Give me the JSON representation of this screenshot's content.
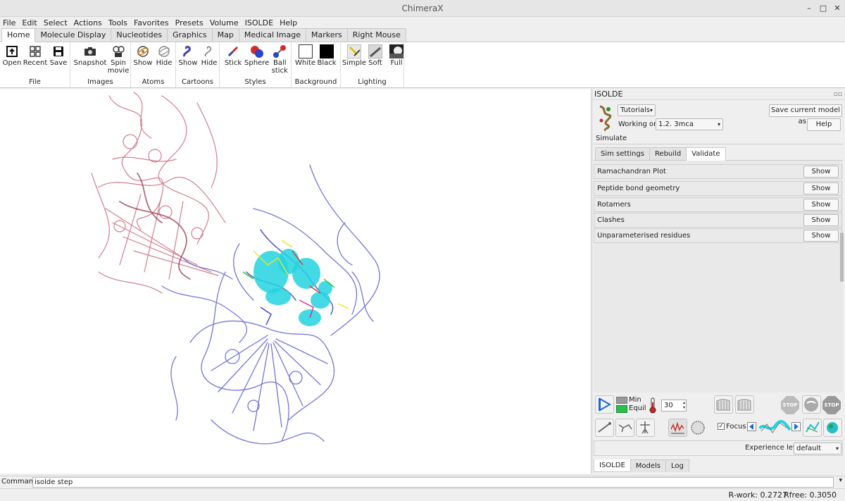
{
  "window": {
    "title": "ChimeraX",
    "minimize": "–",
    "maximize": "□",
    "close": "✕"
  },
  "menu": [
    "File",
    "Edit",
    "Select",
    "Actions",
    "Tools",
    "Favorites",
    "Presets",
    "Volume",
    "ISOLDE",
    "Help"
  ],
  "tabs": [
    "Home",
    "Molecule Display",
    "Nucleotides",
    "Graphics",
    "Map",
    "Medical Image",
    "Markers",
    "Right Mouse"
  ],
  "ribbon": {
    "file": {
      "label": "File",
      "buttons": [
        "Open",
        "Recent",
        "Save"
      ]
    },
    "images": {
      "label": "Images",
      "buttons": [
        "Snapshot",
        "Spin movie"
      ]
    },
    "atoms": {
      "label": "Atoms",
      "buttons": [
        "Show",
        "Hide"
      ]
    },
    "cartoons": {
      "label": "Cartoons",
      "buttons": [
        "Show",
        "Hide"
      ]
    },
    "styles": {
      "label": "Styles",
      "buttons": [
        "Stick",
        "Sphere",
        "Ball stick"
      ]
    },
    "background": {
      "label": "Background",
      "buttons": [
        "White",
        "Black"
      ]
    },
    "lighting": {
      "label": "Lighting",
      "buttons": [
        "Simple",
        "Soft",
        "Full"
      ]
    }
  },
  "isolde": {
    "title": "ISOLDE",
    "tutorials": "Tutorials",
    "save_model": "Save current model as...",
    "working_on_label": "Working on:",
    "working_on_value": "1.2. 3mca",
    "help": "Help",
    "simulate_label": "Simulate",
    "subtabs": [
      "Sim settings",
      "Rebuild",
      "Validate"
    ],
    "active_subtab": "Validate",
    "validate_rows": [
      {
        "label": "Ramachandran Plot",
        "button": "Show"
      },
      {
        "label": "Peptide bond geometry",
        "button": "Show"
      },
      {
        "label": "Rotamers",
        "button": "Show"
      },
      {
        "label": "Clashes",
        "button": "Show"
      },
      {
        "label": "Unparameterised residues",
        "button": "Show"
      }
    ],
    "min_label": "Min",
    "equil_label": "Equil",
    "temperature": "30",
    "focus_label": "Focus",
    "focus_checked": true,
    "experience_label": "Experience level",
    "experience_value": "default",
    "bottom_tabs": [
      "ISOLDE",
      "Models",
      "Log"
    ],
    "stop_label": "STOP"
  },
  "command": {
    "label": "Command:",
    "value": "isolde step"
  },
  "status": {
    "r_work": "R-work: 0.2727",
    "r_free": "Rfree: 0.3050"
  },
  "colors": {
    "accent": "#2d6fd8",
    "map_cyan": "#22d3e0",
    "chain_red": "#c0566a",
    "chain_blue": "#4a50c8"
  }
}
